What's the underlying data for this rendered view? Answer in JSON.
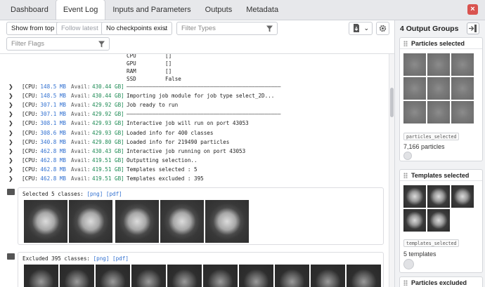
{
  "tabs": [
    "Dashboard",
    "Event Log",
    "Inputs and Parameters",
    "Outputs",
    "Metadata"
  ],
  "active_tab": "Event Log",
  "toolbar": {
    "show_from_top": "Show from top",
    "follow_latest": "Follow latest",
    "checkpoints": "No checkpoints exist",
    "filter_types_placeholder": "Filter Types",
    "filter_flags_placeholder": "Filter Flags"
  },
  "system_info": [
    {
      "key": "CPU",
      "value": "[]"
    },
    {
      "key": "GPU",
      "value": "[]"
    },
    {
      "key": "RAM",
      "value": "[]"
    },
    {
      "key": "SSD",
      "value": "False"
    }
  ],
  "log_rows": [
    {
      "mb": "148.5 MB",
      "gb": "430.44 GB]",
      "msg": "————————————————————————————————————————————————"
    },
    {
      "mb": "148.5 MB",
      "gb": "430.44 GB]",
      "msg": "Importing job module for job type select_2D..."
    },
    {
      "mb": "307.1 MB",
      "gb": "429.92 GB]",
      "msg": "Job ready to run"
    },
    {
      "mb": "307.1 MB",
      "gb": "429.92 GB]",
      "msg": "————————————————————————————————————————————————"
    },
    {
      "mb": "308.1 MB",
      "gb": "429.93 GB]",
      "msg": "Interactive job will run on port 43053"
    },
    {
      "mb": "308.6 MB",
      "gb": "429.93 GB]",
      "msg": "Loaded info for 400 classes"
    },
    {
      "mb": "340.8 MB",
      "gb": "429.80 GB]",
      "msg": "Loaded info for 219490 particles"
    },
    {
      "mb": "462.8 MB",
      "gb": "430.43 GB]",
      "msg": "Interactive job running on port 43053"
    },
    {
      "mb": "462.8 MB",
      "gb": "419.51 GB]",
      "msg": "Outputting selection.."
    },
    {
      "mb": "462.8 MB",
      "gb": "419.51 GB]",
      "msg": "Templates selected : 5"
    },
    {
      "mb": "462.8 MB",
      "gb": "419.51 GB]",
      "msg": "Templates excluded : 395"
    }
  ],
  "log_labels": {
    "cpu": "[CPU:",
    "avail": "Avail:"
  },
  "selected_block": {
    "title": "Selected 5 classes:",
    "png": "[png]",
    "pdf": "[pdf]"
  },
  "excluded_block": {
    "title": "Excluded 395 classes:",
    "png": "[png]",
    "pdf": "[pdf]"
  },
  "right_panel": {
    "title": "4 Output Groups",
    "groups": [
      {
        "name": "Particles selected",
        "badge": "particles_selected",
        "count": "7,166 particles"
      },
      {
        "name": "Templates selected",
        "badge": "templates_selected",
        "count": "5 templates"
      },
      {
        "name": "Particles excluded"
      }
    ]
  }
}
